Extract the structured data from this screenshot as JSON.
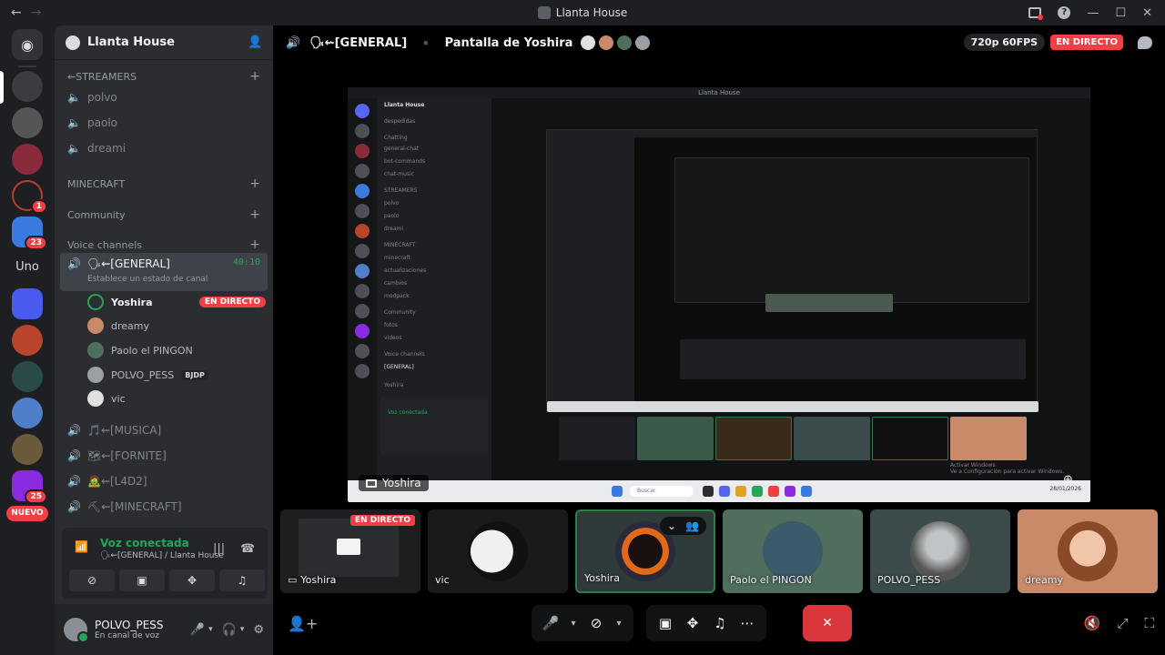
{
  "window": {
    "title": "Llanta House"
  },
  "rail": {
    "home_icon": "discord-icon",
    "badges": [
      "1",
      "23",
      "25"
    ],
    "uno_label": "Uno",
    "nuevo_label": "NUEVO",
    "server_colors": [
      "#3a3c40",
      "#555",
      "#8a2a3a",
      "#c23a2a",
      "#3b7be0",
      "#4a5cf0",
      "#b8442a",
      "#2b4a4a",
      "#4f7fc8",
      "#6b5a3a",
      "#8a2be2"
    ]
  },
  "sidebar": {
    "guild_name": "Llanta House",
    "categories": {
      "streamers": "⇜STREAMERS",
      "minecraft": "MINECRAFT",
      "community": "Community",
      "voice": "Voice channels"
    },
    "streamer_channels": [
      "polvo",
      "paolo",
      "dreami"
    ],
    "active_channel": {
      "name": "🗣⇜[GENERAL]",
      "timer": "40:10",
      "status": "Establece un estado de canal"
    },
    "voice_users": [
      {
        "name": "Yoshira",
        "live": "EN DIRECTO"
      },
      {
        "name": "dreamy"
      },
      {
        "name": "Paolo el PINGON"
      },
      {
        "name": "POLVO_PESS",
        "tag": "BJDP"
      },
      {
        "name": "vic"
      }
    ],
    "other_voice_channels": [
      "🎵⇜[MUSICA]",
      "🗺⇜[FORNITE]",
      "🧟⇜[L4D2]",
      "⛏⇜[MINECRAFT]"
    ]
  },
  "voice_panel": {
    "title": "Voz conectada",
    "subtitle": "🗣⇜[GENERAL] / Llanta House"
  },
  "user_panel": {
    "name": "POLVO_PESS",
    "status": "En canal de voz"
  },
  "header": {
    "channel": "🗣⇜[GENERAL]",
    "screen_title": "Pantalla de Yoshira",
    "quality": "720p 60FPS",
    "live": "EN DIRECTO"
  },
  "stream": {
    "label": "Yoshira",
    "inner_title": "Llanta House",
    "inner_rows": [
      "despedidas",
      "Chatting",
      "general-chat",
      "bot-commands",
      "chat-music",
      "STREAMERS",
      "polvo",
      "paolo",
      "dreami",
      "MINECRAFT",
      "minecraft",
      "actualizaciones",
      "cambios",
      "modpack",
      "Community",
      "fotos",
      "videos",
      "Voice channels",
      "[GENERAL]",
      "Yoshira"
    ],
    "inner_voice": "Voz conectada",
    "inner_search": "Buscar",
    "watermark_1": "Activar Windows",
    "watermark_2": "Ve a Configuración para activar Windows.",
    "clock": "28/01/2026"
  },
  "tiles": [
    {
      "name": "Yoshira",
      "live": "EN DIRECTO",
      "type": "screen",
      "color": "#1d1e20"
    },
    {
      "name": "vic",
      "type": "avatar",
      "color": "#1a1a1a",
      "circle": "#f0f0f0"
    },
    {
      "name": "Yoshira",
      "type": "avatar",
      "color": "#2f3a3a",
      "circle": "#e06a1a",
      "selected": true
    },
    {
      "name": "Paolo el PINGON",
      "type": "avatar",
      "color": "#4f6e5e",
      "circle": "#4f6e5e"
    },
    {
      "name": "POLVO_PESS",
      "type": "avatar",
      "color": "#3b4a4a",
      "circle": "#9aa0a3"
    },
    {
      "name": "dreamy",
      "type": "avatar",
      "color": "#c98a6a",
      "circle": "#d48a6a"
    }
  ]
}
